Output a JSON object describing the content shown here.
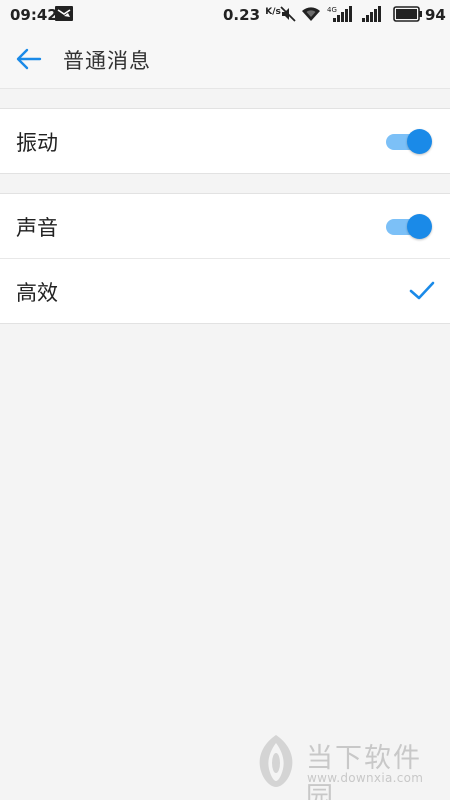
{
  "status_bar": {
    "time": "09:42",
    "net_speed": "0.23",
    "net_speed_unit": "K/s",
    "network_type": "4G",
    "battery_level": "94"
  },
  "header": {
    "title": "普通消息"
  },
  "settings": {
    "vibration": {
      "label": "振动",
      "enabled": true
    },
    "sound": {
      "label": "声音",
      "enabled": true
    },
    "efficient": {
      "label": "高效",
      "selected": true
    }
  },
  "watermark": {
    "brand": "当下软件园",
    "url": "www.downxia.com"
  },
  "colors": {
    "accent": "#1a8ae8",
    "accent_light": "#7cc0f7",
    "background": "#f4f4f4"
  }
}
